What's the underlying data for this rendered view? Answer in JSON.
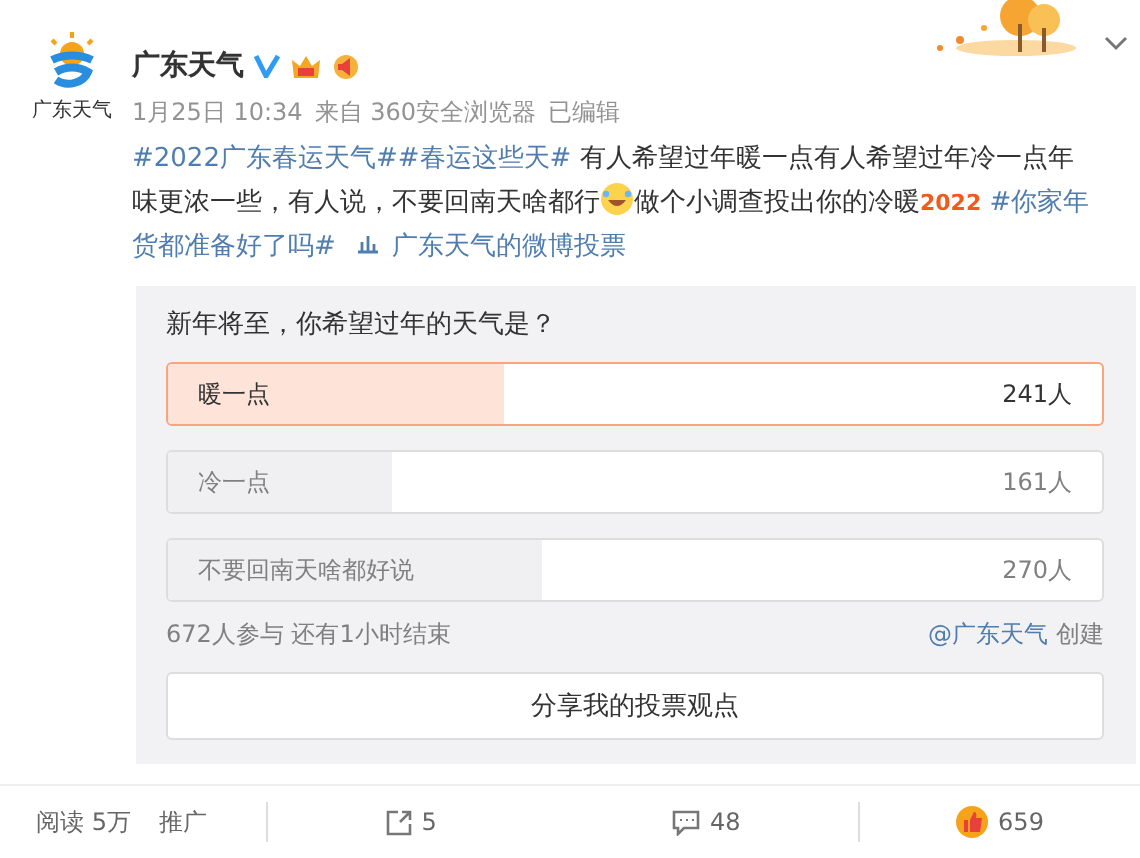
{
  "author": {
    "name": "广东天气",
    "avatar_caption": "广东天气"
  },
  "meta": {
    "date": "1月25日 10:34",
    "source": "来自 360安全浏览器",
    "edited": "已编辑"
  },
  "body": [
    {
      "kind": "tag",
      "text": "#2022广东春运天气#"
    },
    {
      "kind": "tag",
      "text": "#春运这些天#"
    },
    {
      "kind": "text",
      "text": " 有人希望过年暖一点有人希望过年冷一点年味更浓一些，有人说，不要回南天啥都行"
    },
    {
      "kind": "emoji"
    },
    {
      "kind": "text",
      "text": "做个小调查投出你的冷暖"
    },
    {
      "kind": "badge",
      "text": "2022"
    },
    {
      "kind": "tag",
      "text": " #你家年货都准备好了吗#"
    },
    {
      "kind": "link",
      "text": "广东天气的微博投票"
    }
  ],
  "poll": {
    "question": "新年将至，你希望过年的天气是？",
    "options": [
      {
        "label": "暖一点",
        "count": "241人",
        "level": 0.36,
        "selected": true
      },
      {
        "label": "冷一点",
        "count": "161人",
        "level": 0.24,
        "selected": false
      },
      {
        "label": "不要回南天啥都好说",
        "count": "270人",
        "level": 0.4,
        "selected": false
      }
    ],
    "summary": "672人参与 还有1小时结束",
    "creator": "@广东天气",
    "creator_suffix": "创建",
    "share": "分享我的投票观点"
  },
  "footer": {
    "reads": "阅读 5万",
    "promote": "推广",
    "reposts": "5",
    "comments": "48",
    "likes": "659"
  }
}
